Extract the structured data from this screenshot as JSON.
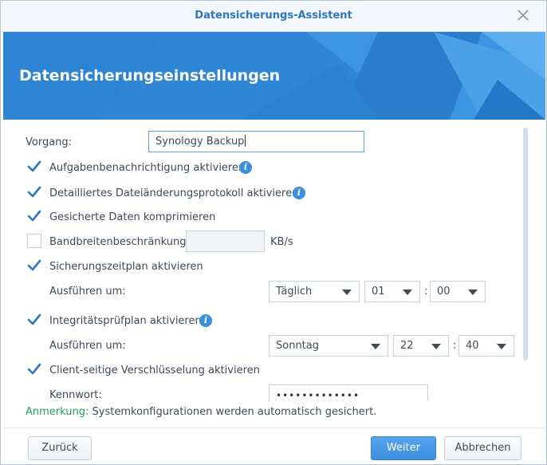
{
  "window": {
    "title": "Datensicherungs-Assistent"
  },
  "banner": {
    "title": "Datensicherungseinstellungen"
  },
  "form": {
    "task_label": "Vorgang:",
    "task_value": "Synology Backup",
    "task_notification": {
      "label": "Aufgabenbenachrichtigung aktivieren",
      "checked": true
    },
    "detailed_log": {
      "label": "Detailliertes Dateiänderungsprotokoll aktivieren",
      "checked": true
    },
    "compress": {
      "label": "Gesicherte Daten komprimieren",
      "checked": true
    },
    "bandwidth": {
      "label": "Bandbreitenbeschränkung",
      "checked": false,
      "value": "",
      "unit": "KB/s"
    },
    "backup_schedule": {
      "label": "Sicherungszeitplan aktivieren",
      "checked": true,
      "run_at_label": "Ausführen um:",
      "frequency": "Täglich",
      "hour": "01",
      "separator": ":",
      "minute": "00"
    },
    "integrity_schedule": {
      "label": "Integritätsprüfplan aktivieren",
      "checked": true,
      "run_at_label": "Ausführen um:",
      "day": "Sonntag",
      "hour": "22",
      "separator": ":",
      "minute": "40"
    },
    "encryption": {
      "label": "Client-seitige Verschlüsselung aktivieren",
      "checked": true
    },
    "password": {
      "label": "Kennwort:",
      "value": "•••••••••••••"
    }
  },
  "note": {
    "key": "Anmerkung:",
    "text": " Systemkonfigurationen werden automatisch gesichert."
  },
  "buttons": {
    "back": "Zurück",
    "next": "Weiter",
    "cancel": "Abbrechen"
  },
  "colors": {
    "accent": "#2a78c4",
    "banner": "#2f88d8",
    "check": "#2a78c4",
    "note": "#1fa05c"
  },
  "icons": {
    "close": "close-icon",
    "info": "info-icon",
    "check": "checkmark-icon",
    "dropdown": "chevron-down-icon"
  }
}
